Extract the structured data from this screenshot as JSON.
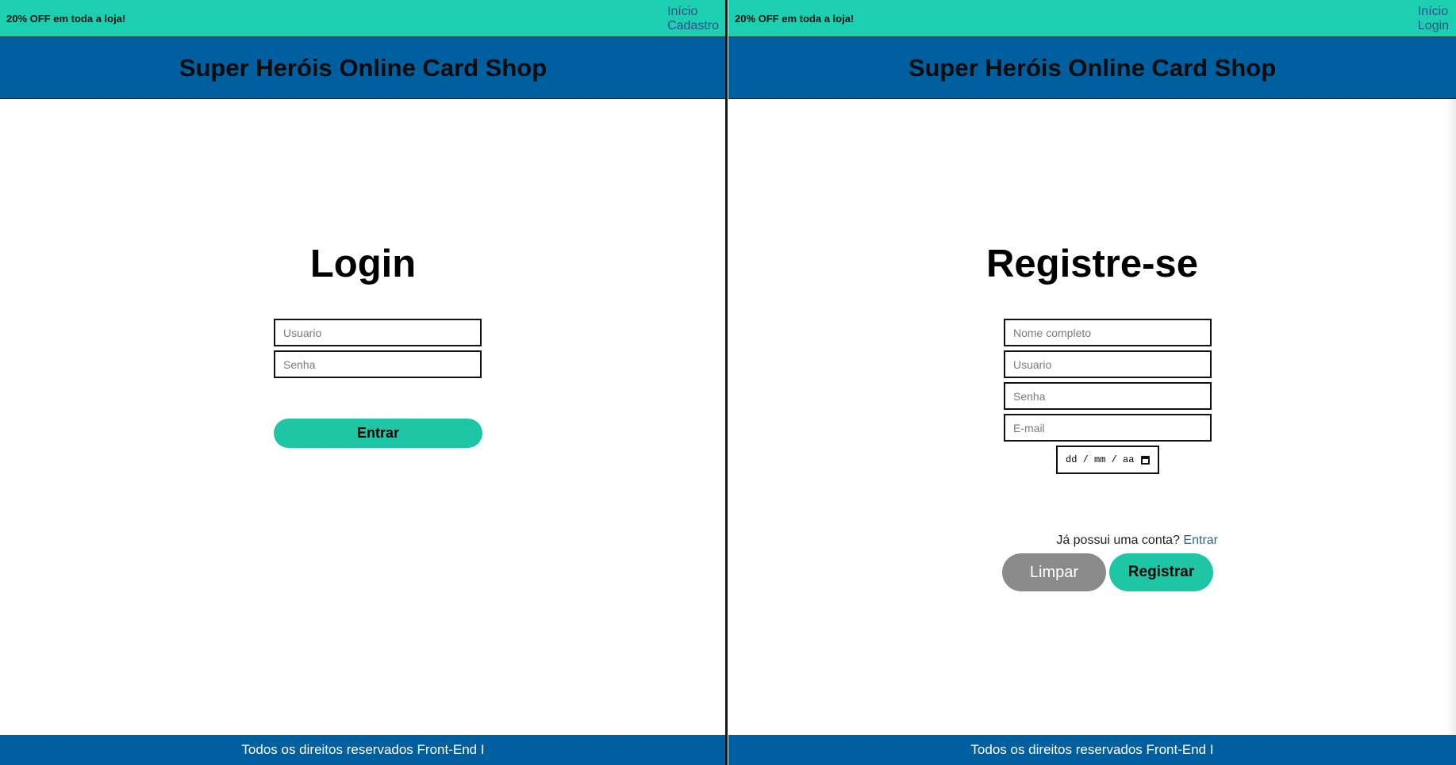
{
  "left": {
    "promo": "20% OFF em toda a loja!",
    "nav": [
      "Início",
      "Cadastro"
    ],
    "header_title": "Super Heróis Online Card Shop",
    "form_title": "Login",
    "fields": {
      "username_placeholder": "Usuario",
      "password_placeholder": "Senha"
    },
    "submit_label": "Entrar",
    "footer": "Todos os direitos reservados Front-End I"
  },
  "right": {
    "promo": "20% OFF em toda a loja!",
    "nav": [
      "Início",
      "Login"
    ],
    "header_title": "Super Heróis Online Card Shop",
    "form_title": "Registre-se",
    "fields": {
      "fullname_placeholder": "Nome completo",
      "username_placeholder": "Usuario",
      "password_placeholder": "Senha",
      "email_placeholder": "E-mail",
      "date_placeholder": "dd / mm / aa"
    },
    "have_account_text": "Já possui uma conta?",
    "have_account_link": "Entrar",
    "clear_label": "Limpar",
    "register_label": "Registrar",
    "footer": "Todos os direitos reservados Front-End I"
  },
  "colors": {
    "topbar": "#1ccfb0",
    "header": "#005f9e",
    "accent_button": "#1ec6a6",
    "clear_button": "#8a8a8a",
    "footer": "#005f9e"
  },
  "icons": {
    "date_picker": "calendar-icon"
  }
}
